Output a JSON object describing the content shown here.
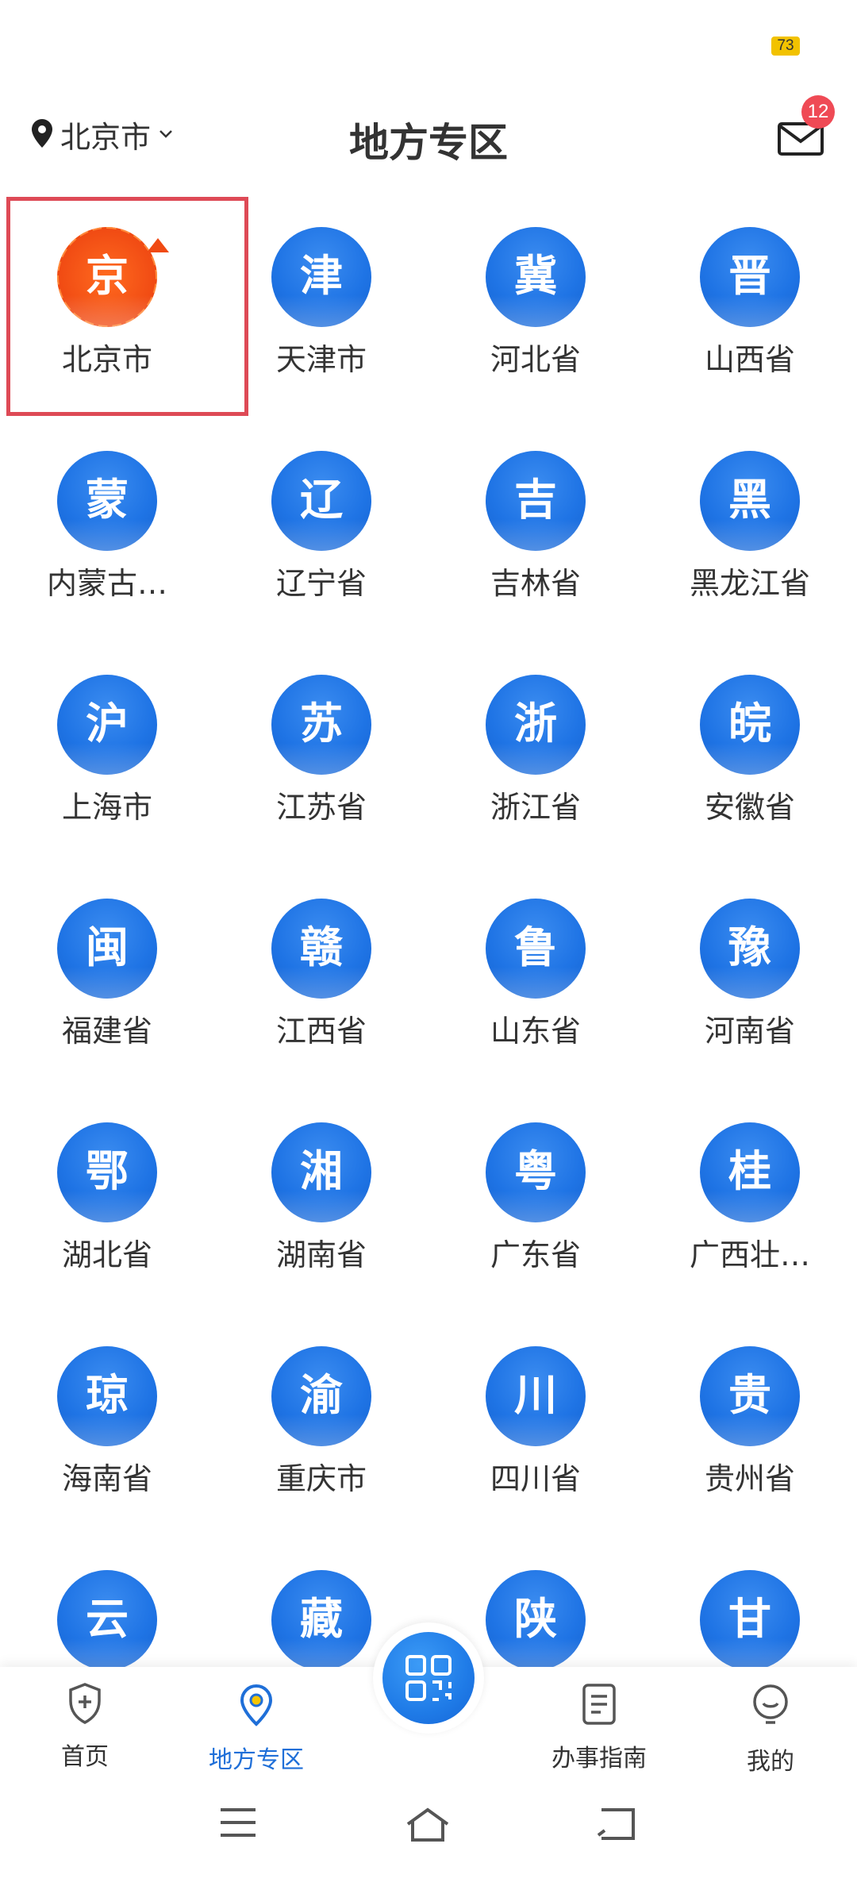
{
  "status": {
    "battery": "73"
  },
  "header": {
    "location": "北京市",
    "title": "地方专区",
    "mail_badge": "12"
  },
  "regions": [
    {
      "char": "京",
      "name": "北京市"
    },
    {
      "char": "津",
      "name": "天津市"
    },
    {
      "char": "冀",
      "name": "河北省"
    },
    {
      "char": "晋",
      "name": "山西省"
    },
    {
      "char": "蒙",
      "name": "内蒙古…"
    },
    {
      "char": "辽",
      "name": "辽宁省"
    },
    {
      "char": "吉",
      "name": "吉林省"
    },
    {
      "char": "黑",
      "name": "黑龙江省"
    },
    {
      "char": "沪",
      "name": "上海市"
    },
    {
      "char": "苏",
      "name": "江苏省"
    },
    {
      "char": "浙",
      "name": "浙江省"
    },
    {
      "char": "皖",
      "name": "安徽省"
    },
    {
      "char": "闽",
      "name": "福建省"
    },
    {
      "char": "赣",
      "name": "江西省"
    },
    {
      "char": "鲁",
      "name": "山东省"
    },
    {
      "char": "豫",
      "name": "河南省"
    },
    {
      "char": "鄂",
      "name": "湖北省"
    },
    {
      "char": "湘",
      "name": "湖南省"
    },
    {
      "char": "粤",
      "name": "广东省"
    },
    {
      "char": "桂",
      "name": "广西壮…"
    },
    {
      "char": "琼",
      "name": "海南省"
    },
    {
      "char": "渝",
      "name": "重庆市"
    },
    {
      "char": "川",
      "name": "四川省"
    },
    {
      "char": "贵",
      "name": "贵州省"
    },
    {
      "char": "云",
      "name": ""
    },
    {
      "char": "藏",
      "name": ""
    },
    {
      "char": "陕",
      "name": ""
    },
    {
      "char": "甘",
      "name": ""
    }
  ],
  "bottom_nav": {
    "home": "首页",
    "region": "地方专区",
    "guide": "办事指南",
    "mine": "我的"
  },
  "colors": {
    "accent": "#1f6fd8",
    "highlight": "#de4a56",
    "badge": "#ef4a55",
    "beijing": "#f04a13"
  }
}
